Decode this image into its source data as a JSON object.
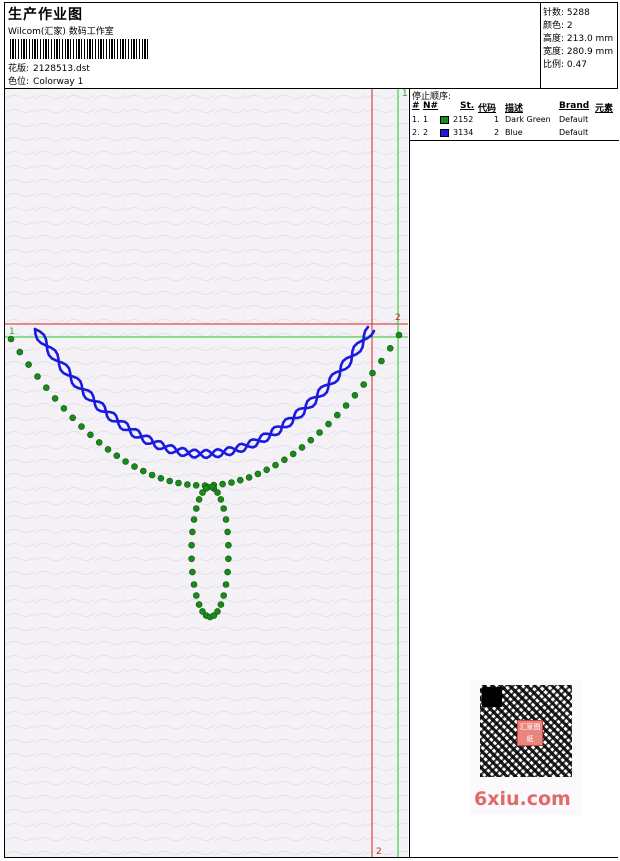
{
  "header": {
    "title": "生产作业图",
    "studio": "Wilcom(汇家) 数码工作室",
    "design_label": "花版:",
    "design_value": "2128513.dst",
    "colorway_label": "色位:",
    "colorway_value": "Colorway 1"
  },
  "stats": [
    {
      "label": "针数:",
      "value": "5288"
    },
    {
      "label": "颜色:",
      "value": "2"
    },
    {
      "label": "高度:",
      "value": "213.0 mm"
    },
    {
      "label": "宽度:",
      "value": "280.9 mm"
    },
    {
      "label": "比例:",
      "value": "0.47"
    }
  ],
  "stop_sequence": {
    "title": "停止顺序:",
    "columns": [
      "#",
      "N#",
      "St.",
      "代码",
      "描述",
      "Brand",
      "元素"
    ],
    "rows": [
      {
        "index": "1.",
        "n": "1",
        "color": "#1a8a1a",
        "st": "2152",
        "code": "1",
        "desc": "Dark Green",
        "brand": "Default"
      },
      {
        "index": "2.",
        "n": "2",
        "color": "#1a1ae0",
        "st": "3134",
        "code": "2",
        "desc": "Blue",
        "brand": "Default"
      }
    ]
  },
  "guides": {
    "green_h": "1",
    "green_v": "1",
    "red_h": "2",
    "red_v": "2"
  },
  "colors": {
    "green": "#1a8a1a",
    "blue": "#1a1ae0",
    "guide_red": "#dd2222",
    "guide_green": "#22cc22"
  },
  "watermark": {
    "text": "6xiu.com",
    "stamp": "汇家图纸"
  }
}
